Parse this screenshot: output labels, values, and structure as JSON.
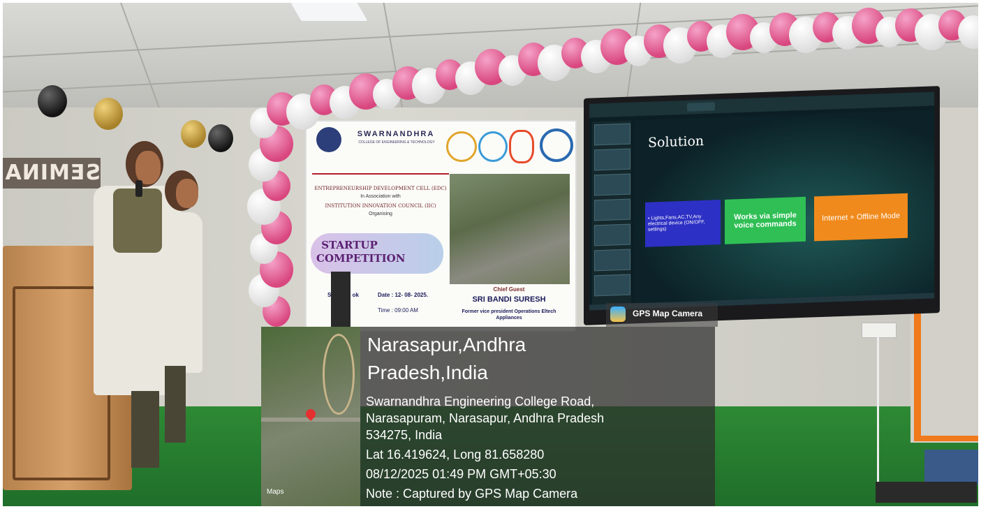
{
  "banner": {
    "college_name": "SWARNANDHRA",
    "college_subtitle": "COLLEGE OF ENGINEERING & TECHNOLOGY",
    "edc": "ENTREPRENEURSHIP DEVELOPMENT CELL (EDC)",
    "association": "In Association with",
    "iic": "INSTITUTION INNOVATION COUNCIL (IIC)",
    "organising": "Organising",
    "event": "STARTUP COMPETITION",
    "date": "Date : 12- 08- 2025.",
    "time": "Time : 09:00 AM",
    "chief_guest_label": "Chief Guest",
    "chief_guest_name": "SRI BANDI SURESH",
    "chief_guest_role": "Former vice president Operations Eltech Appliances",
    "partial_left": "Se all De ok"
  },
  "wall_sign": "SEMINAR H",
  "slide": {
    "title": "Solution",
    "cards": [
      {
        "text": "• Lights,Fans,AC,TV,Any electrical device (ON/OFF, settings)"
      },
      {
        "text": "Works via simple voice commands"
      },
      {
        "text": "Internet + Offline Mode"
      }
    ]
  },
  "gps": {
    "app_name": "GPS Map Camera",
    "city": "Narasapur,Andhra Pradesh,India",
    "address_line1": "Swarnandhra Engineering College Road,",
    "address_line2": "Narasapuram, Narasapur, Andhra Pradesh",
    "address_line3": "534275, India",
    "coords": "Lat 16.419624, Long 81.658280",
    "datetime": "08/12/2025 01:49 PM GMT+05:30",
    "note": "Note : Captured by GPS Map Camera",
    "maps_label": "Maps"
  }
}
